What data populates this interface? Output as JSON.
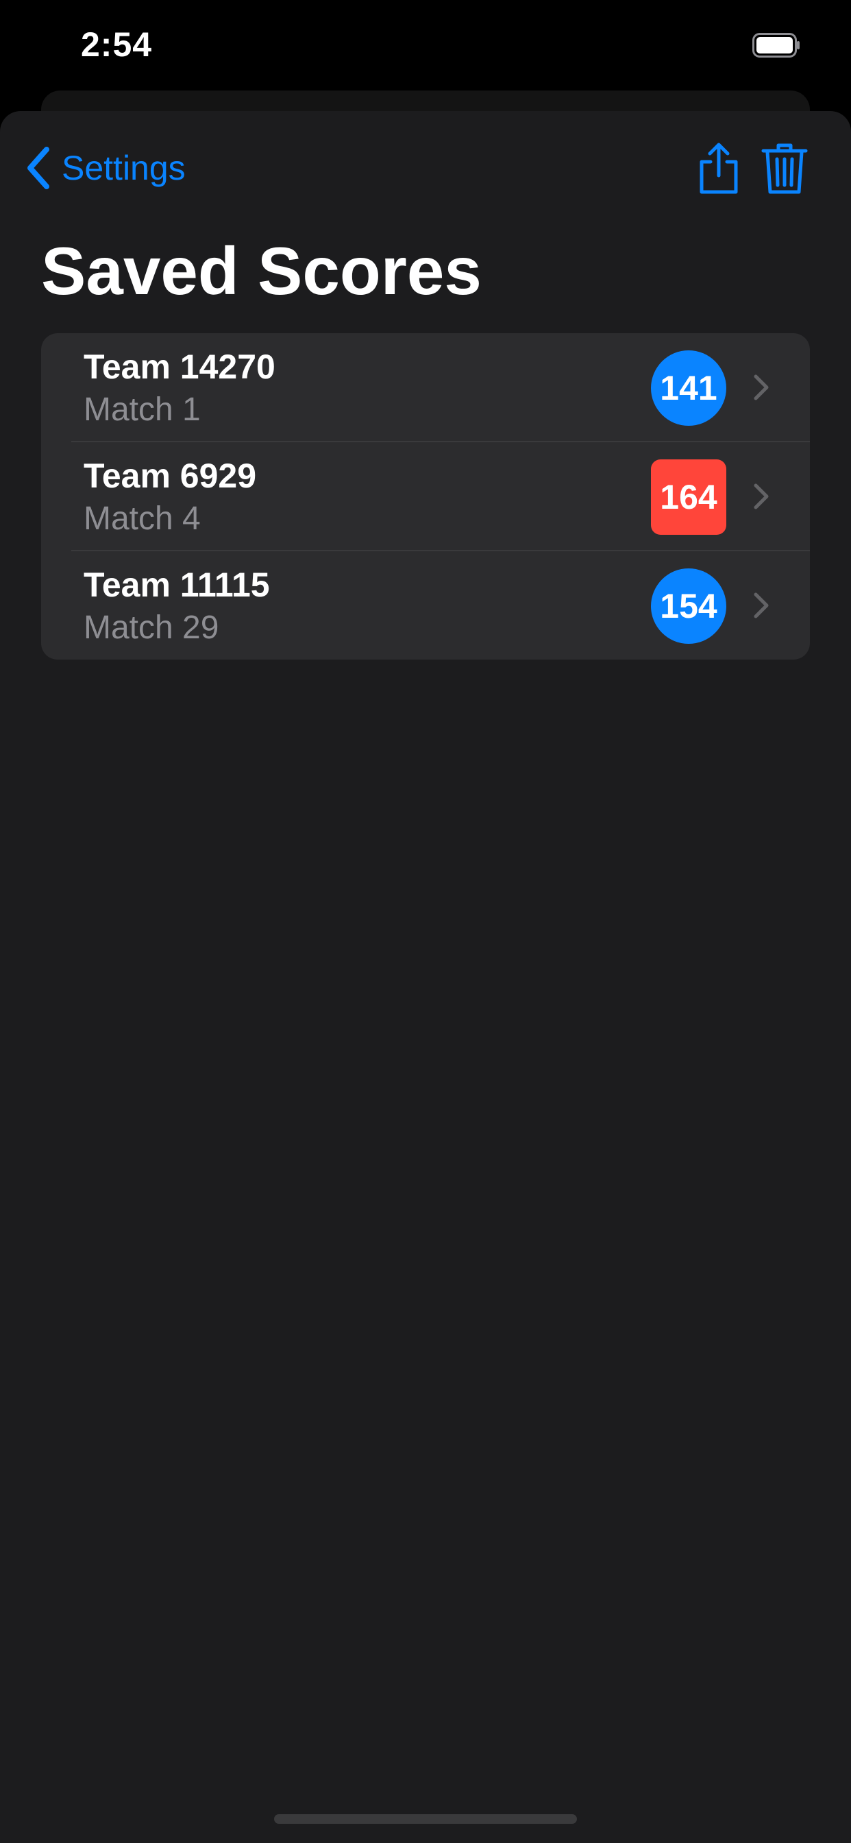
{
  "status_bar": {
    "time": "2:54",
    "battery_icon": "battery-full-icon"
  },
  "nav": {
    "back_label": "Settings",
    "back_icon": "chevron-left-icon",
    "share_icon": "share-icon",
    "trash_icon": "trash-icon",
    "accent_color": "#0a84ff"
  },
  "page": {
    "title": "Saved Scores"
  },
  "scores": [
    {
      "team": "Team 14270",
      "match": "Match 1",
      "score": "141",
      "badge_shape": "circle",
      "badge_color": "#0a84ff"
    },
    {
      "team": "Team 6929",
      "match": "Match 4",
      "score": "164",
      "badge_shape": "square",
      "badge_color": "#ff453a"
    },
    {
      "team": "Team 11115",
      "match": "Match 29",
      "score": "154",
      "badge_shape": "circle",
      "badge_color": "#0a84ff"
    }
  ]
}
